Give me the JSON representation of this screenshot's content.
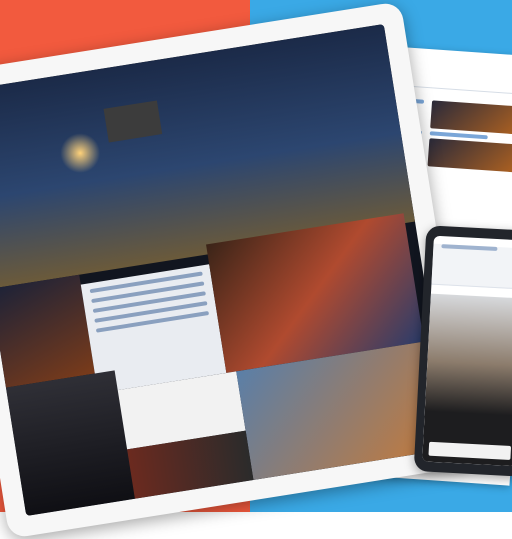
{
  "colors": {
    "left_background": "#f25a3e",
    "right_background": "#3aa9e6"
  },
  "browser": {
    "logo_text": "",
    "header_actions": ""
  },
  "tablet": {
    "hero_title": "",
    "hero_subtitle": "",
    "hero_subtitle_2": ""
  },
  "phone": {}
}
